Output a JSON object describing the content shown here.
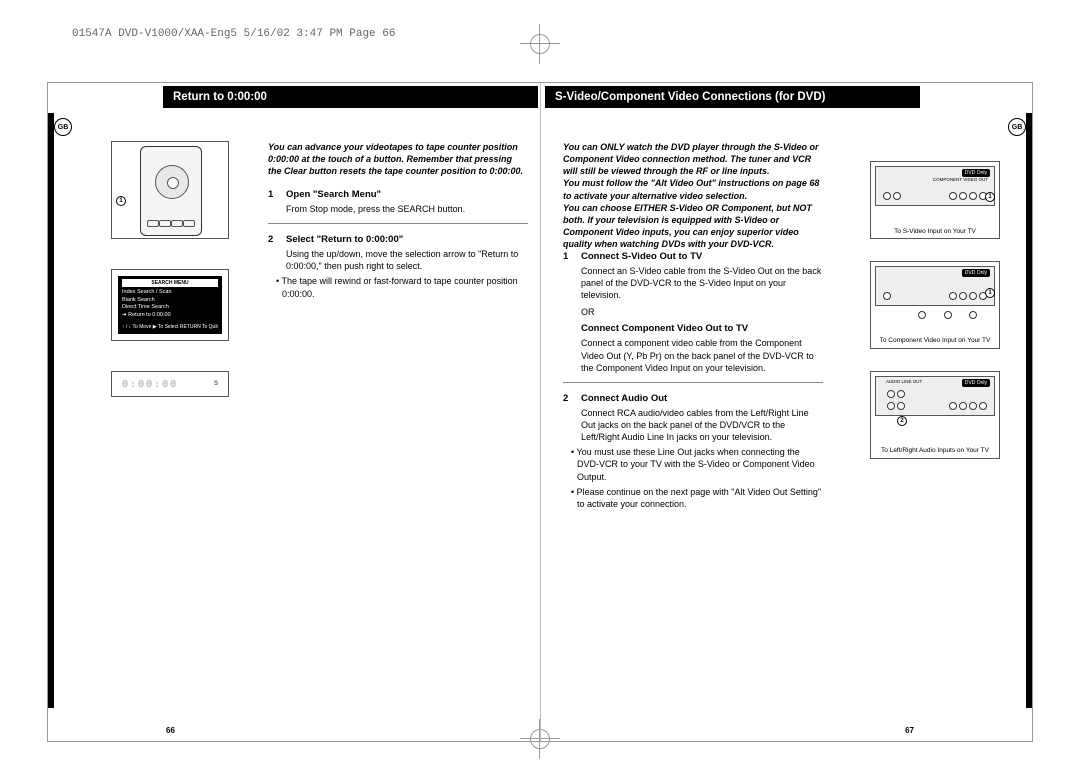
{
  "header": "01547A DVD-V1000/XAA-Eng5  5/16/02 3:47 PM  Page 66",
  "gb_label": "GB",
  "left_page": {
    "title": "Return to 0:00:00",
    "intro": "You can advance your videotapes to tape counter position 0:00:00 at the touch of a button. Remember that pressing the Clear button resets the tape counter position to 0:00:00.",
    "steps": [
      {
        "num": "1",
        "title": "Open \"Search Menu\"",
        "body": "From Stop mode, press the SEARCH button."
      },
      {
        "num": "2",
        "title": "Select \"Return to 0:00:00\"",
        "body": "Using the up/down, move the selection arrow to \"Return to 0:00:00,\" then push right to select.",
        "bullet": "The tape will rewind or fast-forward to tape counter position 0:00:00."
      }
    ],
    "menu": {
      "title": "SEARCH MENU",
      "items": [
        "Index Search / Scan",
        "Blank Search",
        "Direct Time Search",
        "➔ Return to 0:00:00"
      ],
      "footer": "↑ / ↓  To Move     ▶ To Select\nRETURN To Quit"
    },
    "vfd_digits": "0:00:00",
    "vfd_s": "S",
    "callout1": "1",
    "page_num": "66"
  },
  "right_page": {
    "title": "S-Video/Component Video Connections (for DVD)",
    "intro": "You can ONLY watch the DVD player through the S-Video or Component Video connection method. The tuner and VCR will still be viewed through the RF or line inputs.\nYou must follow the \"Alt Video Out\" instructions on page 68 to activate your alternative video selection.\nYou can choose EITHER S-Video OR Component, but NOT both. If your television is equipped with S-Video or Component Video inputs, you can enjoy superior video quality when watching DVDs with your DVD-VCR.",
    "steps": [
      {
        "num": "1",
        "title": "Connect S-Video Out to TV",
        "body": "Connect an S-Video cable from the S-Video Out on the back panel of the DVD-VCR to the S-Video Input on your television.",
        "or": "OR",
        "sub_title": "Connect Component Video Out to TV",
        "sub_body": "Connect a component video cable from the Component Video Out (Y, Pb Pr) on the back panel of the DVD-VCR to the Component Video Input on your television."
      },
      {
        "num": "2",
        "title": "Connect Audio Out",
        "body": "Connect RCA audio/video cables from the Left/Right Line Out jacks on the back panel of the DVD/VCR to the Left/Right Audio Line In jacks on your television.",
        "bullets": [
          "You must use these Line Out jacks when connecting the DVD-VCR to your TV with the S-Video or Component Video Output.",
          "Please continue on the next page with \"Alt Video Out Setting\" to activate your connection."
        ]
      }
    ],
    "dia1_tag": "DVD Only",
    "dia1_lbl": "COMPONENT VIDEO OUT",
    "dia1_cap": "To S-Video Input on Your TV",
    "dia2_tag": "DVD Only",
    "dia2_cap": "To Component Video Input on Your TV",
    "dia3_tag": "DVD Only",
    "dia3_lbls": "AUDIO   LINE OUT",
    "dia3_cap": "To Left/Right Audio Inputs on Your TV",
    "call1": "1",
    "call2": "1",
    "call3": "2",
    "page_num": "67"
  }
}
